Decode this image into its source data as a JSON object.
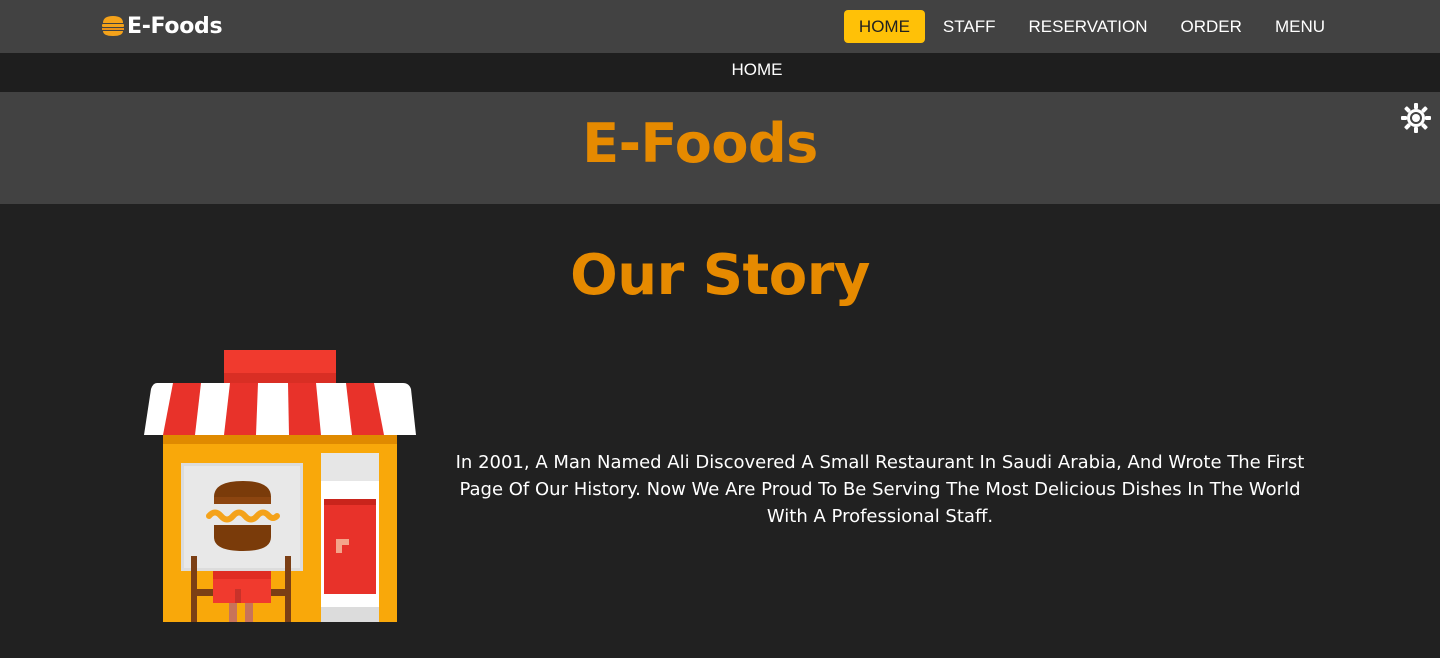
{
  "brand": {
    "name": "E-Foods",
    "icon": "burger-icon"
  },
  "nav": {
    "items": [
      {
        "label": "HOME",
        "active": true
      },
      {
        "label": "STAFF",
        "active": false
      },
      {
        "label": "RESERVATION",
        "active": false
      },
      {
        "label": "ORDER",
        "active": false
      },
      {
        "label": "MENU",
        "active": false
      }
    ]
  },
  "breadcrumb": {
    "current": "HOME"
  },
  "hero": {
    "title": "E-Foods",
    "theme_toggle_icon": "sun-icon"
  },
  "story": {
    "title": "Our Story",
    "illustration": "restaurant-storefront-icon",
    "text": "In 2001, A Man Named Ali Discovered A Small Restaurant In Saudi Arabia, And Wrote The First Page Of Our History. Now We Are Proud To Be Serving The Most Delicious Dishes In The World With A Professional Staff."
  },
  "colors": {
    "accent": "#e68a00",
    "active_nav": "#ffc107",
    "navbar_bg": "#424242",
    "page_bg": "#212121"
  }
}
